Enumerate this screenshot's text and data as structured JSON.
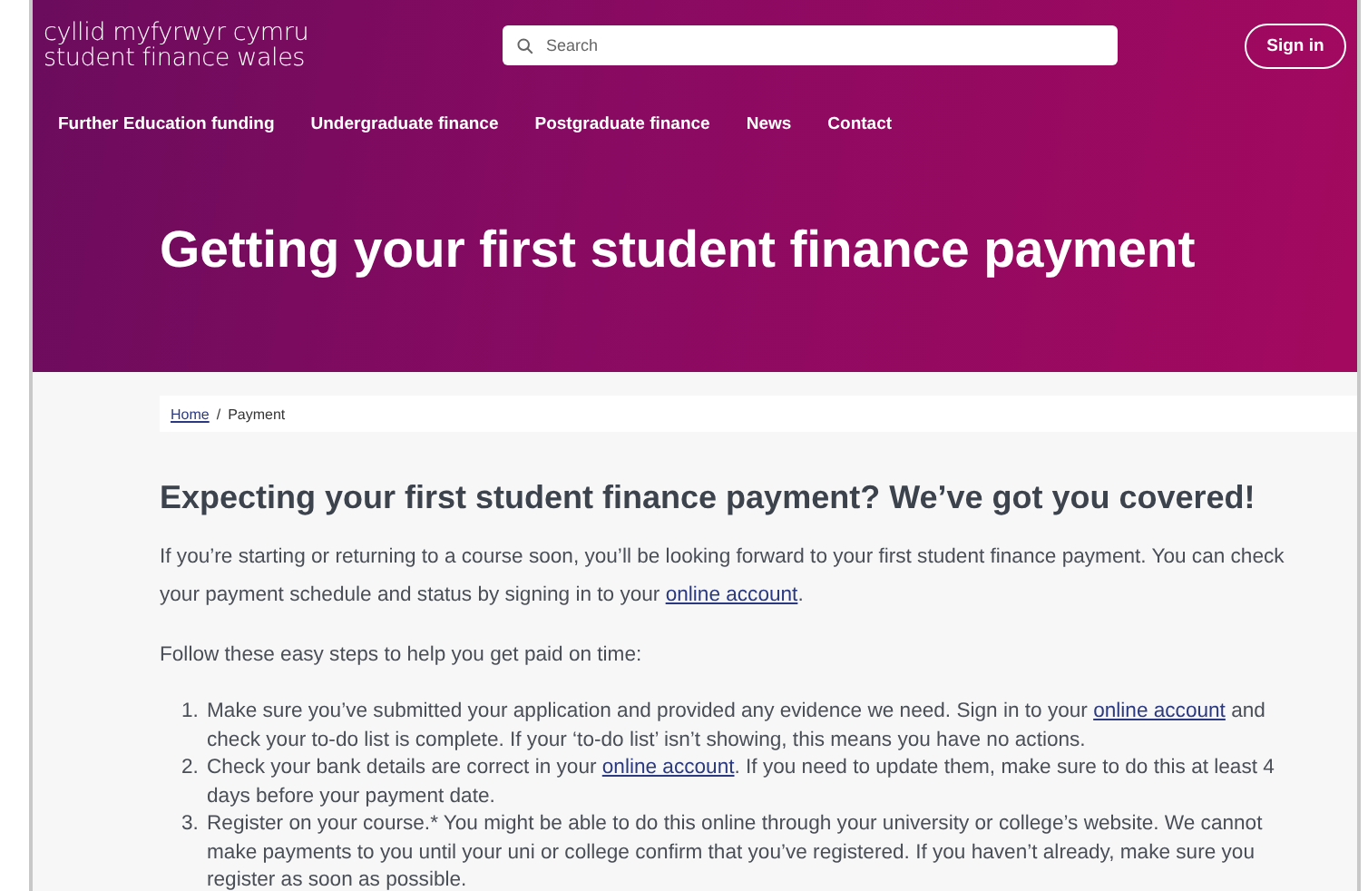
{
  "header": {
    "logo_lines": [
      "cyllid myfyrwyr cymru",
      "student finance wales"
    ],
    "search": {
      "placeholder": "Search"
    },
    "sign_in": "Sign in"
  },
  "nav": [
    "Further Education funding",
    "Undergraduate finance",
    "Postgraduate finance",
    "News",
    "Contact"
  ],
  "hero_title": "Getting your first student finance payment",
  "breadcrumb": {
    "link": "Home",
    "separator": "/",
    "current": "Payment"
  },
  "heading": "Expecting your first student finance payment? We’ve got you covered!",
  "paragraphs": [
    [
      {
        "kind": "text",
        "text": "If you’re starting or returning to a course soon, you’ll be looking forward to your first student finance payment. You can check your payment schedule and status by signing in to your "
      },
      {
        "kind": "link",
        "text": "online account"
      },
      {
        "kind": "text",
        "text": "."
      }
    ],
    [
      {
        "kind": "text",
        "text": "Follow these easy steps to help you get paid on time:"
      }
    ]
  ],
  "steps": [
    {
      "number": "1.",
      "parts": [
        {
          "kind": "text",
          "text": "Make sure you’ve submitted your application and provided any evidence we need. Sign in to your "
        },
        {
          "kind": "link",
          "text": "online account"
        },
        {
          "kind": "text",
          "text": " and check your to-do list is complete. If your ‘to-do list’ isn’t showing, this means you have no actions."
        }
      ]
    },
    {
      "number": "2.",
      "parts": [
        {
          "kind": "text",
          "text": "Check your bank details are correct in your "
        },
        {
          "kind": "link",
          "text": "online account"
        },
        {
          "kind": "text",
          "text": ". If you need to update them, make sure to do this at least 4 days before your payment date."
        }
      ]
    },
    {
      "number": "3.",
      "parts": [
        {
          "kind": "text",
          "text": "Register on your course.* You might be able to do this online through your university or college’s website. We cannot make payments to you until your uni or college confirm that you’ve registered. If you haven’t already, make sure you register as soon as possible."
        }
      ]
    }
  ]
}
